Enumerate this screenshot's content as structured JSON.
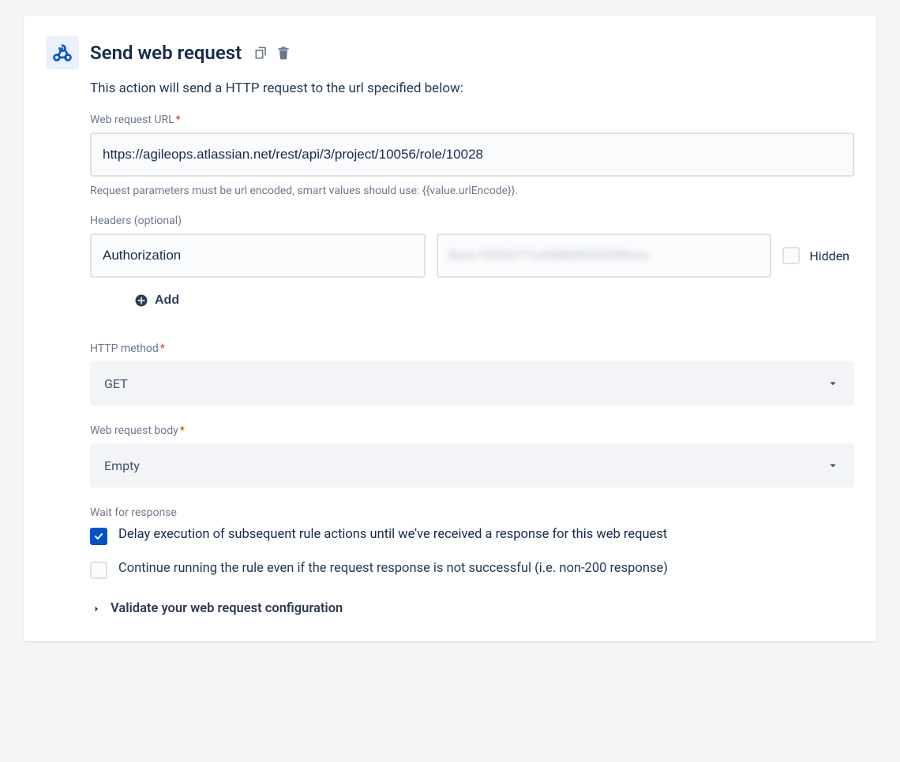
{
  "page": {
    "title": "Send web request",
    "description": "This action will send a HTTP request to the url specified below:"
  },
  "url_field": {
    "label": "Web request URL",
    "required": "*",
    "value": "https://agileops.atlassian.net/rest/api/3/project/10056/role/10028",
    "help": "Request parameters must be url encoded, smart values should use: {{value.urlEncode}}."
  },
  "headers": {
    "label": "Headers (optional)",
    "key_value": "Authorization",
    "value_masked": "Basic YXVlb2Y1TndGMkbR0Z2hZW9wcy",
    "hidden_label": "Hidden",
    "add_label": "Add"
  },
  "method": {
    "label": "HTTP method",
    "required": "*",
    "value": "GET"
  },
  "body": {
    "label": "Web request body",
    "required": "*",
    "value": "Empty"
  },
  "wait": {
    "label": "Wait for response",
    "option1": "Delay execution of subsequent rule actions until we've received a response for this web request",
    "option2": "Continue running the rule even if the request response is not successful (i.e. non-200 response)"
  },
  "validate": {
    "label": "Validate your web request configuration"
  }
}
